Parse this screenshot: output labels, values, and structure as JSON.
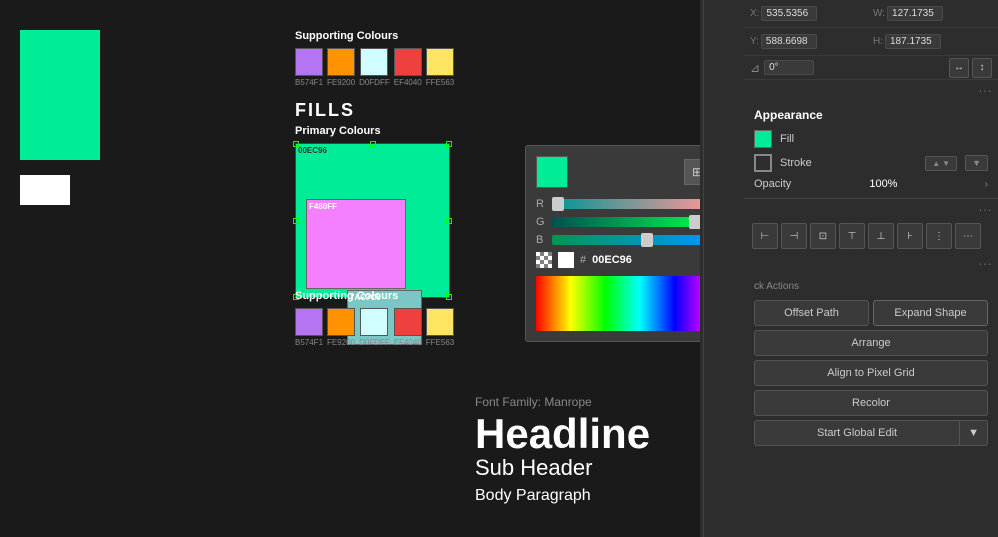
{
  "canvas": {
    "teal_block": {
      "color": "#00EC96"
    },
    "fills_title": "FILLS"
  },
  "supporting_top": {
    "label": "Supporting Colours",
    "swatches": [
      {
        "color": "#B574F1",
        "label": "B574F1"
      },
      {
        "color": "#FE9200",
        "label": "FE9200"
      },
      {
        "color": "#D0FDFF",
        "label": "D0FDFF"
      },
      {
        "color": "#EF4040",
        "label": "EF4040"
      },
      {
        "color": "#FFE563",
        "label": "FFE563"
      }
    ]
  },
  "primary_colours": {
    "label": "Primary Colours",
    "main_color": "#00EC96",
    "inner_color": "#F480FF",
    "inner2_color": "#7AC7C6",
    "labels": [
      "00EC96",
      "F480FF",
      "7AC7C6"
    ]
  },
  "supporting_bottom": {
    "label": "Supporting Colours",
    "swatches": [
      {
        "color": "#B574F1",
        "label": "B574F1"
      },
      {
        "color": "#FE9200",
        "label": "FE9200"
      },
      {
        "color": "#D0FDFF",
        "label": "D0FDFF"
      },
      {
        "color": "#EF4040",
        "label": "EF4040"
      },
      {
        "color": "#FFE563",
        "label": "FFE563"
      }
    ]
  },
  "typography": {
    "font_family": "Font Family: Manrope",
    "headline": "Headline",
    "subheader": "Sub Header",
    "body": "Body Paragraph"
  },
  "color_picker": {
    "hex_value": "00EC96",
    "r_value": "0",
    "g_value": "236",
    "b_value": "150",
    "r_label": "R",
    "g_label": "G",
    "b_label": "B",
    "hash": "#"
  },
  "panel": {
    "x_label": "X:",
    "x_value": "535.5356",
    "y_label": "Y:",
    "y_value": "588.6698",
    "w_label": "W:",
    "w_value": "127.1735",
    "h_label": "H:",
    "h_value": "187.1735",
    "angle_label": "⦿",
    "angle_value": "0°",
    "appearance_title": "Appearance",
    "fill_label": "Fill",
    "stroke_label": "Stroke",
    "opacity_label": "Opacity",
    "opacity_value": "100%",
    "quick_actions_title": "ck Actions",
    "offset_path_btn": "Offset Path",
    "expand_shape_btn": "Expand Shape",
    "arrange_btn": "Arrange",
    "align_pixel_btn": "Align to Pixel Grid",
    "recolor_btn": "Recolor",
    "start_global_edit_btn": "Start Global Edit"
  },
  "toolbar": {
    "icons": [
      "◻",
      "◎",
      "⊞",
      "↕",
      "⊡",
      "↗"
    ]
  }
}
